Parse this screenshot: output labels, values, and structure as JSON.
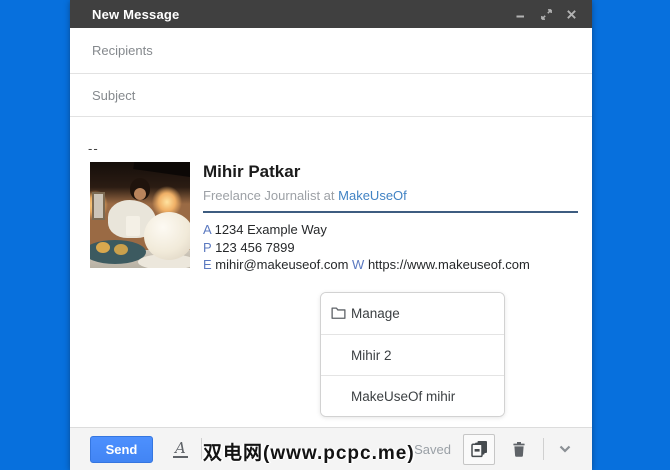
{
  "window": {
    "title": "New Message"
  },
  "fields": {
    "recipients_placeholder": "Recipients",
    "subject_placeholder": "Subject"
  },
  "body": {
    "signature_delimiter": "--",
    "signature": {
      "name": "Mihir Patkar",
      "role": "Freelance Journalist at",
      "company": "MakeUseOf",
      "address_label": "A",
      "address": "1234 Example Way",
      "phone_label": "P",
      "phone": "123 456 7899",
      "email_label": "E",
      "email": "mihir@makeuseof.com",
      "website_label": "W",
      "website": "https://www.makeuseof.com",
      "photo": "man-at-cafe-table-with-coffee-cup"
    }
  },
  "menu": {
    "items": [
      {
        "label": "Manage",
        "icon": "folder-icon"
      },
      {
        "label": "Mihir 2"
      },
      {
        "label": "MakeUseOf mihir"
      }
    ]
  },
  "toolbar": {
    "send_label": "Send",
    "formatting_label": "A",
    "saved_status": "Saved",
    "watermark": "双电网(www.pcpc.me)"
  },
  "colors": {
    "background_blue": "#0770dd",
    "titlebar": "#404040",
    "send_blue": "#4285f4",
    "link_blue": "#4183c4",
    "contact_key_blue": "#5b79c0",
    "signature_rule": "#3d5c80"
  }
}
